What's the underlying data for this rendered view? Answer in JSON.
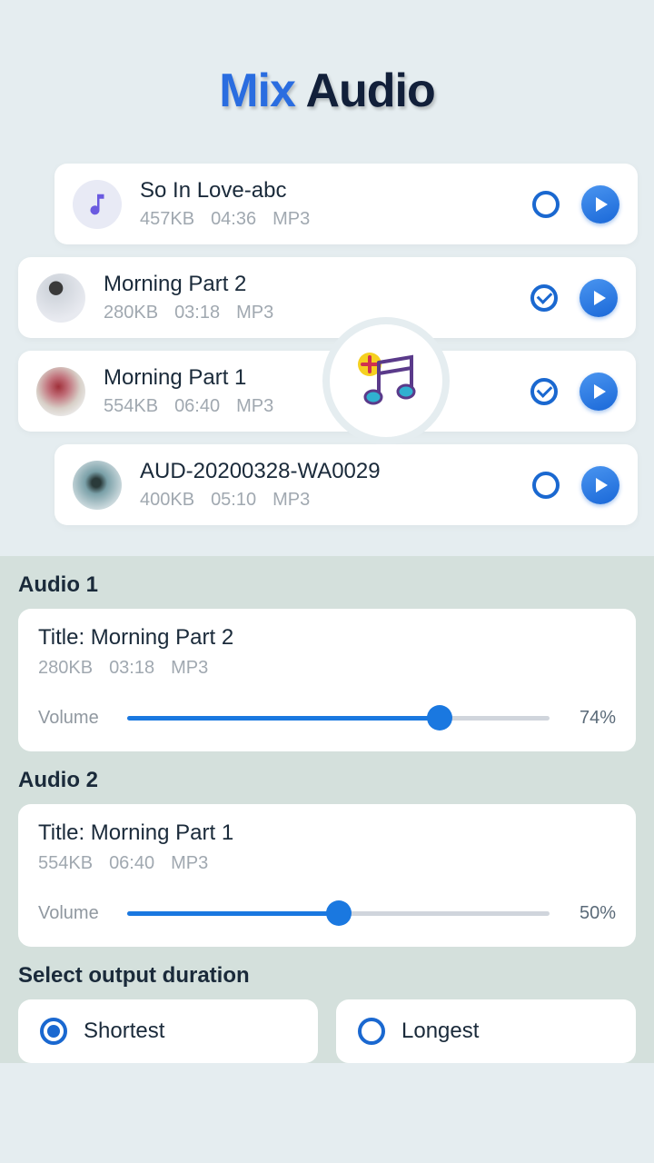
{
  "title": {
    "part1": "Mix",
    "part2": "Audio"
  },
  "tracks": [
    {
      "title": "So In Love-abc",
      "size": "457KB",
      "dur": "04:36",
      "fmt": "MP3",
      "checked": false
    },
    {
      "title": "Morning Part 2",
      "size": "280KB",
      "dur": "03:18",
      "fmt": "MP3",
      "checked": true
    },
    {
      "title": "Morning Part 1",
      "size": "554KB",
      "dur": "06:40",
      "fmt": "MP3",
      "checked": true
    },
    {
      "title": "AUD-20200328-WA0029",
      "size": "400KB",
      "dur": "05:10",
      "fmt": "MP3",
      "checked": false
    }
  ],
  "mix": {
    "audio1": {
      "label": "Audio 1",
      "title": "Title: Morning Part 2",
      "size": "280KB",
      "dur": "03:18",
      "fmt": "MP3",
      "vol_label": "Volume",
      "vol_pct": "74%",
      "vol_val": 74
    },
    "audio2": {
      "label": "Audio 2",
      "title": "Title: Morning Part 1",
      "size": "554KB",
      "dur": "06:40",
      "fmt": "MP3",
      "vol_label": "Volume",
      "vol_pct": "50%",
      "vol_val": 50
    }
  },
  "duration": {
    "label": "Select output duration",
    "opt1": "Shortest",
    "opt2": "Longest",
    "selected": "Shortest"
  }
}
